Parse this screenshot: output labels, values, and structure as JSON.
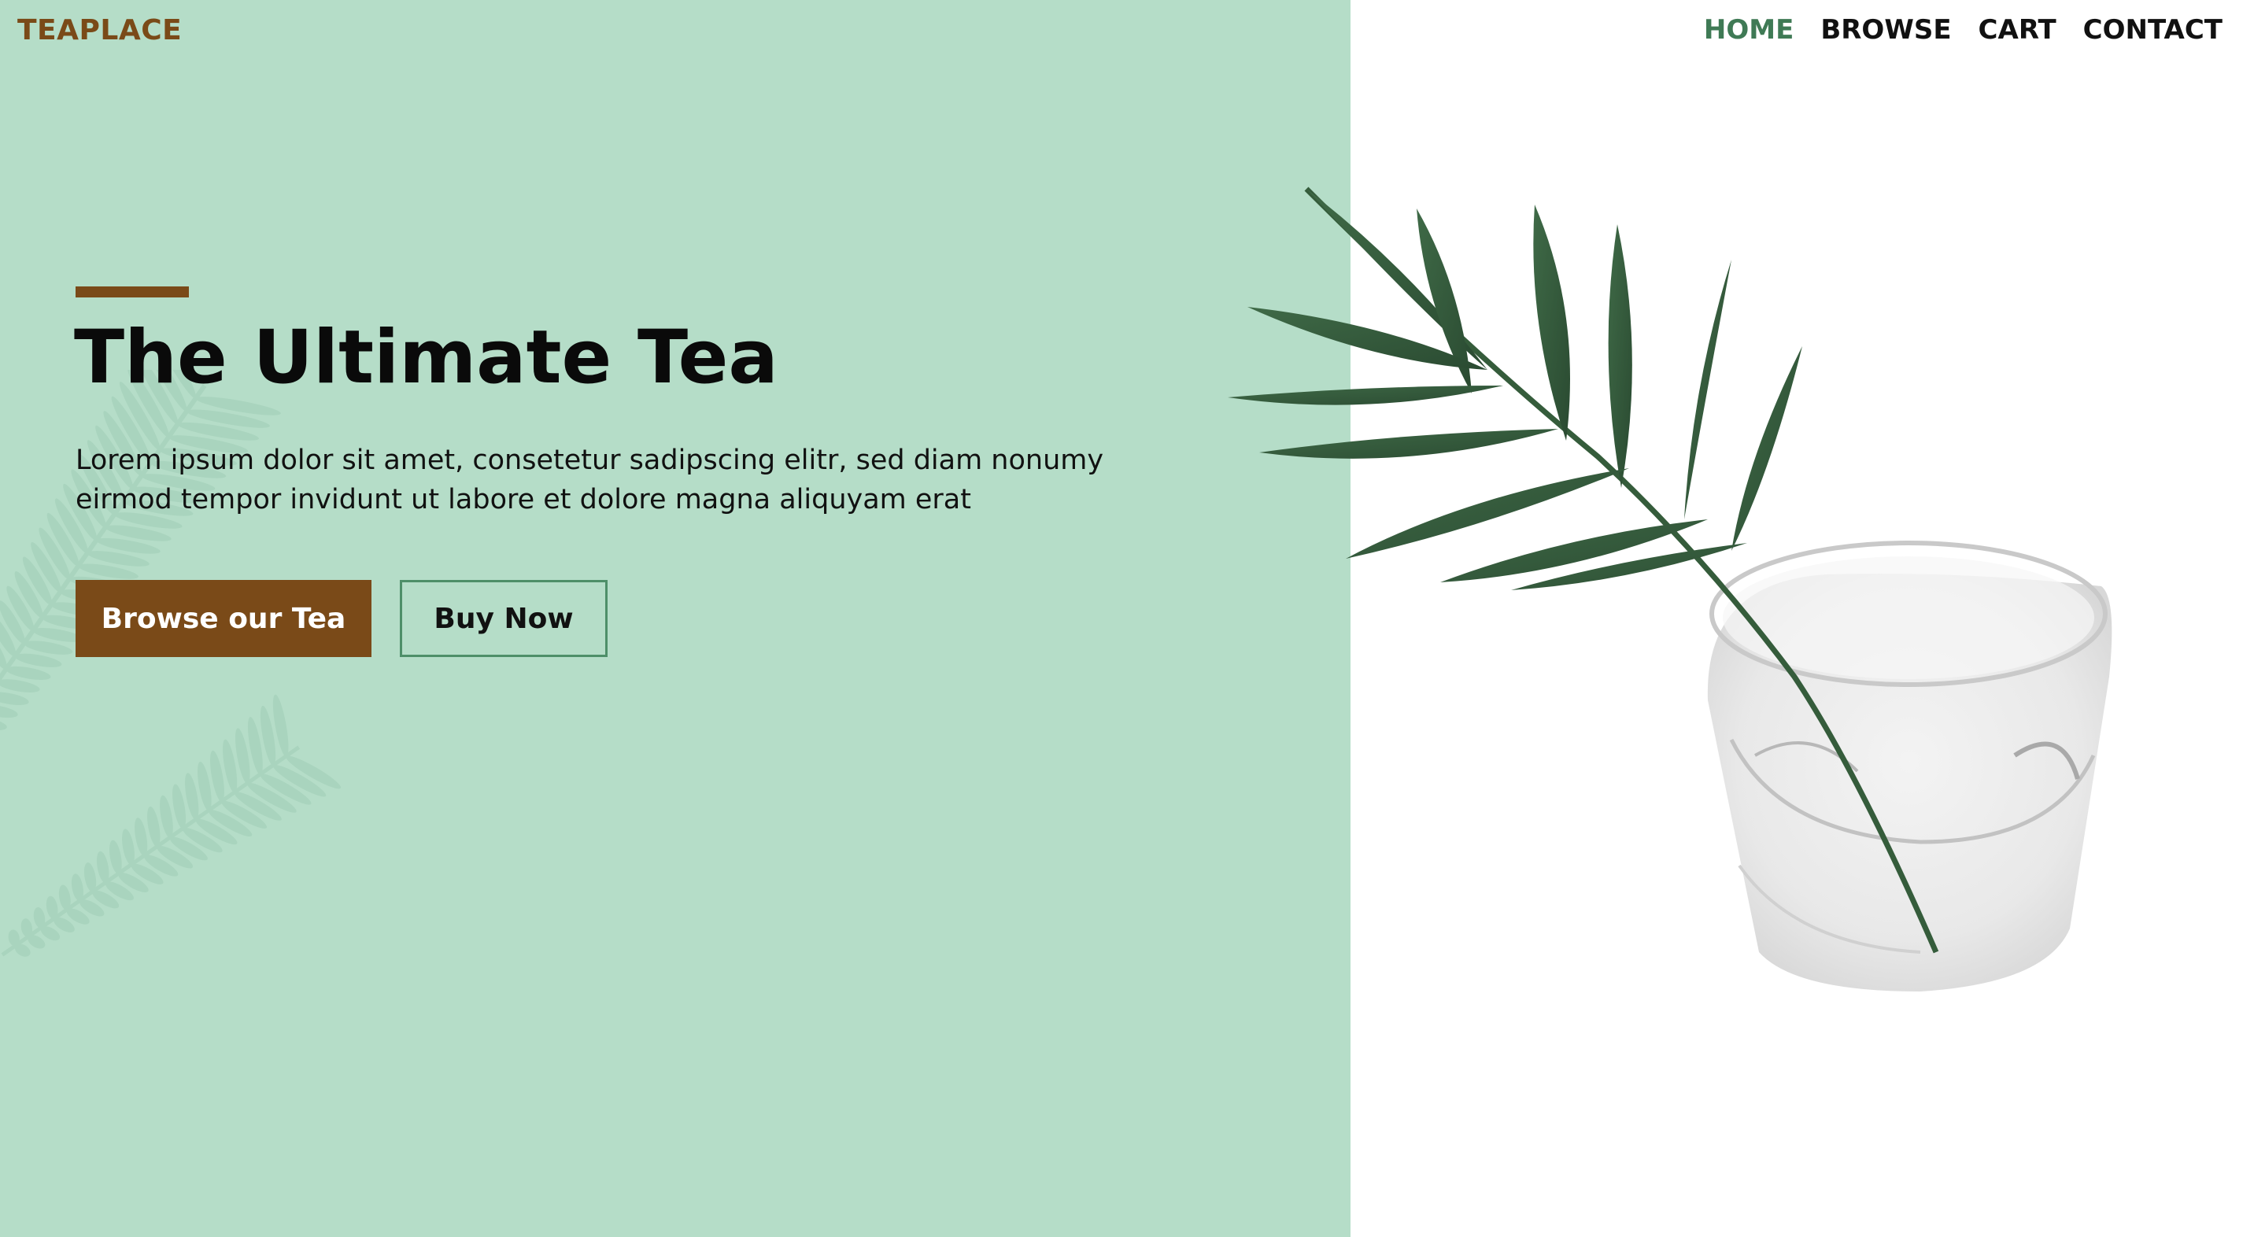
{
  "brand": {
    "logo_text": "TEAPLACE"
  },
  "nav": {
    "items": [
      {
        "label": "HOME",
        "active": true
      },
      {
        "label": "BROWSE",
        "active": false
      },
      {
        "label": "CART",
        "active": false
      },
      {
        "label": "CONTACT",
        "active": false
      }
    ]
  },
  "hero": {
    "title": "The Ultimate Tea",
    "description": "Lorem ipsum dolor sit amet, consetetur sadipscing elitr, sed diam nonumy eirmod tempor invidunt ut labore et dolore magna aliquyam erat",
    "primary_button": "Browse our Tea",
    "secondary_button": "Buy Now"
  },
  "colors": {
    "hero_background": "#b5ddc8",
    "brand_brown": "#7a4a18",
    "active_nav": "#3f7a55",
    "outline_green": "#4e8f69",
    "page_background": "#ffffff"
  },
  "images": {
    "hero_image": "palm-leaf-in-glass-of-water",
    "background_decoration": "fern-silhouette"
  }
}
